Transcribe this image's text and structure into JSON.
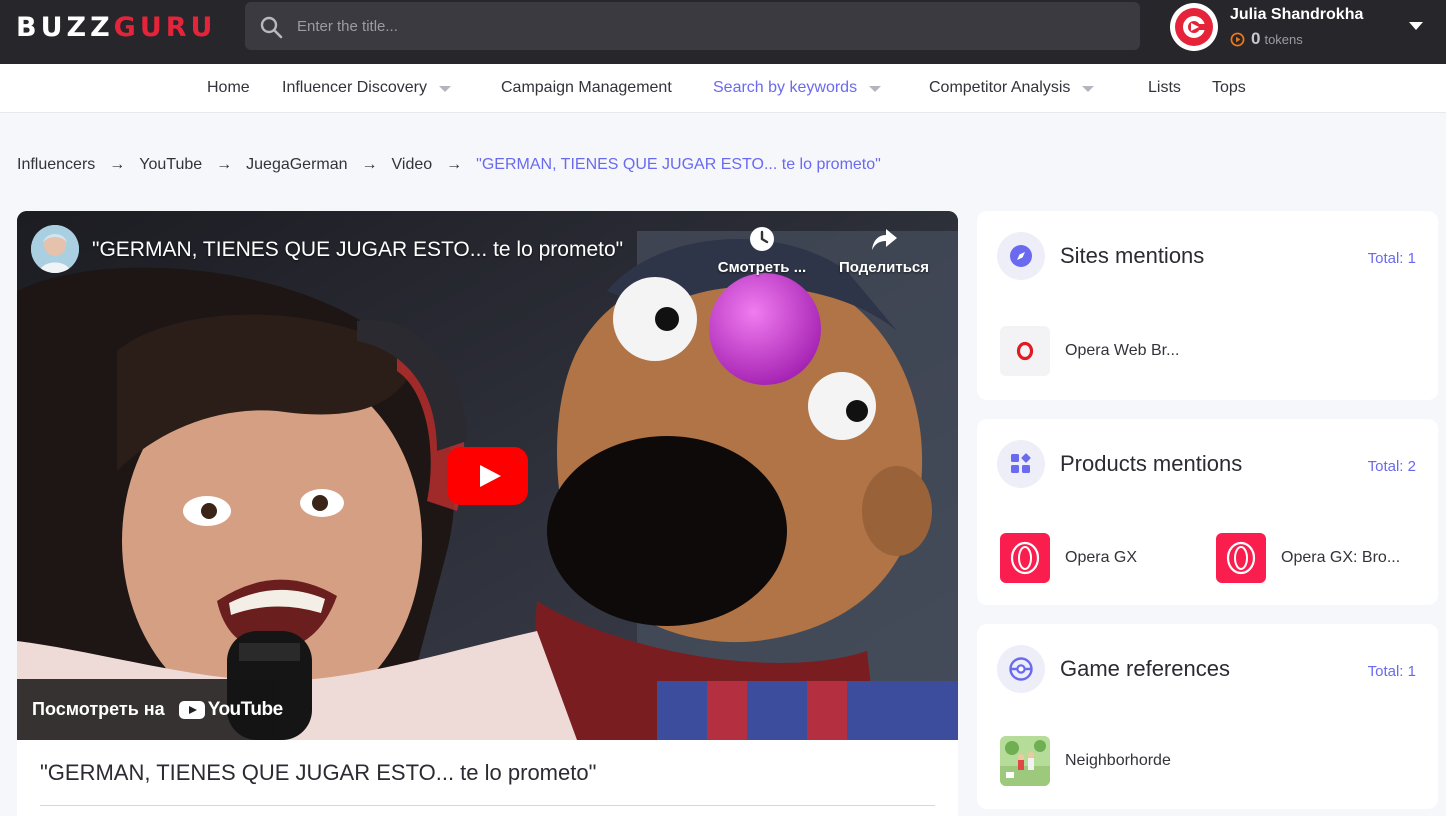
{
  "app": {
    "logo_left": "BUZZ",
    "logo_right": "GURU",
    "brand_color": "#e5243a",
    "accent_color": "#6a6af0"
  },
  "search": {
    "placeholder": "Enter the title...",
    "value": "",
    "icon": "search-icon"
  },
  "user": {
    "name": "Julia Shandrokha",
    "tokens": "0",
    "tokens_label": "tokens"
  },
  "nav": {
    "home": "Home",
    "influencer_discovery": "Influencer Discovery",
    "campaign_management": "Campaign Management",
    "search_by_keywords": "Search by keywords",
    "competitor_analysis": "Competitor Analysis",
    "lists": "Lists",
    "tops": "Tops",
    "active": "search_by_keywords"
  },
  "breadcrumb": {
    "items": [
      "Influencers",
      "YouTube",
      "JuegaGerman",
      "Video"
    ],
    "current": "\"GERMAN, TIENES QUE JUGAR ESTO... te lo prometo\"",
    "separator": "→"
  },
  "video": {
    "embed_title": "\"GERMAN, TIENES QUE JUGAR ESTO... te lo prometo\"",
    "watch_later": "Смотреть ...",
    "share": "Поделиться",
    "watch_on": "Посмотреть на",
    "youtube": "YouTube",
    "title": "\"GERMAN, TIENES QUE JUGAR ESTO... te lo prometo\""
  },
  "sites_mentions": {
    "title": "Sites mentions",
    "total": "Total: 1",
    "items": [
      {
        "name": "Opera Web Br...",
        "icon": "opera-icon"
      }
    ]
  },
  "products_mentions": {
    "title": "Products mentions",
    "total": "Total: 2",
    "items": [
      {
        "name": "Opera GX",
        "icon": "opera-gx-icon"
      },
      {
        "name": "Opera GX: Bro...",
        "icon": "opera-gx-icon"
      }
    ]
  },
  "game_references": {
    "title": "Game references",
    "total": "Total: 1",
    "items": [
      {
        "name": "Neighborhorde",
        "icon": "neighborhorde-thumbnail"
      }
    ]
  }
}
